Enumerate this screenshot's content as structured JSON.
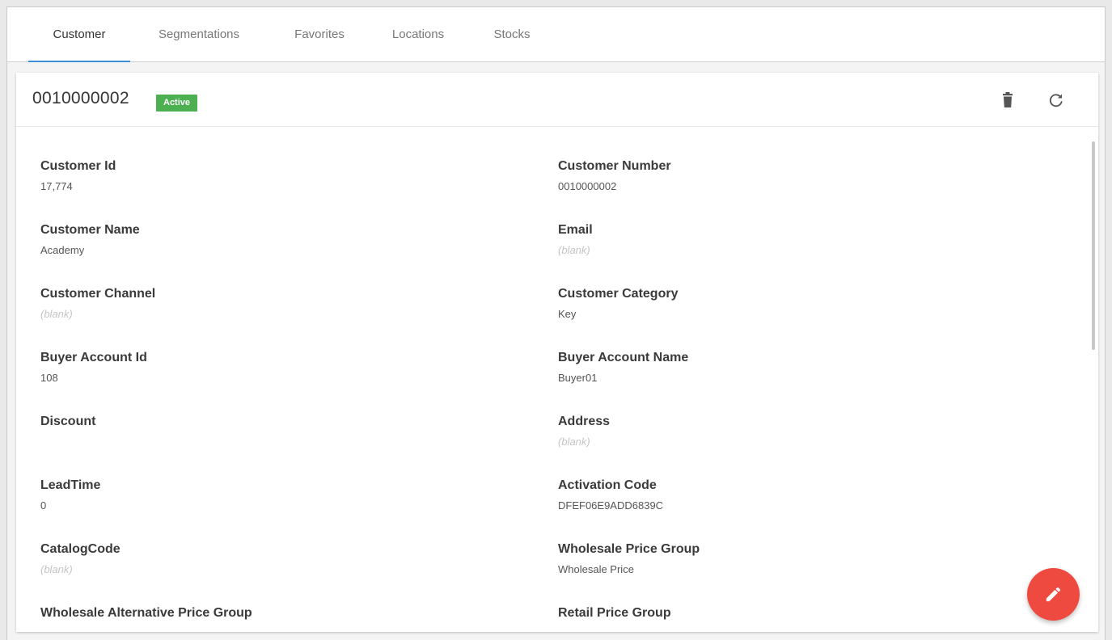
{
  "tabs": [
    {
      "label": "Customer",
      "active": true
    },
    {
      "label": "Segmentations"
    },
    {
      "label": "Favorites"
    },
    {
      "label": "Locations"
    },
    {
      "label": "Stocks"
    }
  ],
  "record": {
    "title": "0010000002",
    "status": "Active",
    "status_color": "#4caf50"
  },
  "actions": {
    "delete_icon": "trash-icon",
    "refresh_icon": "refresh-icon",
    "edit_icon": "pencil-icon",
    "fab_color": "#ef4a3f"
  },
  "fields": [
    {
      "label": "Customer Id",
      "value": "17,774"
    },
    {
      "label": "Customer Number",
      "value": "0010000002"
    },
    {
      "label": "Customer Name",
      "value": "Academy"
    },
    {
      "label": "Email",
      "value": "(blank)",
      "blank": true
    },
    {
      "label": "Customer Channel",
      "value": "(blank)",
      "blank": true
    },
    {
      "label": "Customer Category",
      "value": "Key"
    },
    {
      "label": "Buyer Account Id",
      "value": "108"
    },
    {
      "label": "Buyer Account Name",
      "value": "Buyer01"
    },
    {
      "label": "Discount",
      "value": ""
    },
    {
      "label": "Address",
      "value": "(blank)",
      "blank": true
    },
    {
      "label": "LeadTime",
      "value": "0"
    },
    {
      "label": "Activation Code",
      "value": "DFEF06E9ADD6839C"
    },
    {
      "label": "CatalogCode",
      "value": "(blank)",
      "blank": true
    },
    {
      "label": "Wholesale Price Group",
      "value": "Wholesale Price"
    },
    {
      "label": "Wholesale Alternative Price Group",
      "value": ""
    },
    {
      "label": "Retail Price Group",
      "value": ""
    }
  ]
}
